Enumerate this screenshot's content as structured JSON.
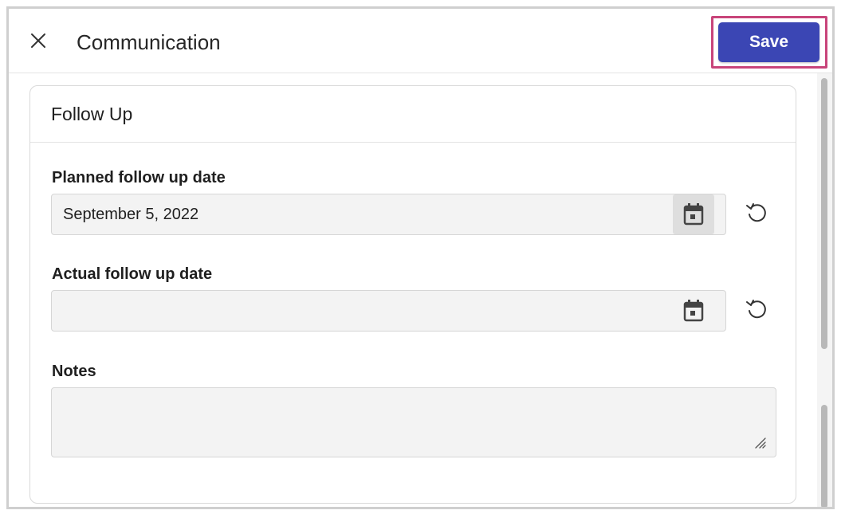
{
  "header": {
    "title": "Communication",
    "save_label": "Save",
    "icons": {
      "close": "close-icon"
    }
  },
  "section": {
    "title": "Follow Up"
  },
  "fields": {
    "planned": {
      "label": "Planned follow up date",
      "value": "September 5, 2022",
      "icon": "calendar-icon",
      "reset_icon": "reset-icon"
    },
    "actual": {
      "label": "Actual follow up date",
      "value": "",
      "icon": "calendar-icon",
      "reset_icon": "reset-icon"
    },
    "notes": {
      "label": "Notes",
      "value": ""
    }
  },
  "colors": {
    "accent": "#3b46b4",
    "highlight": "#c8447a"
  }
}
